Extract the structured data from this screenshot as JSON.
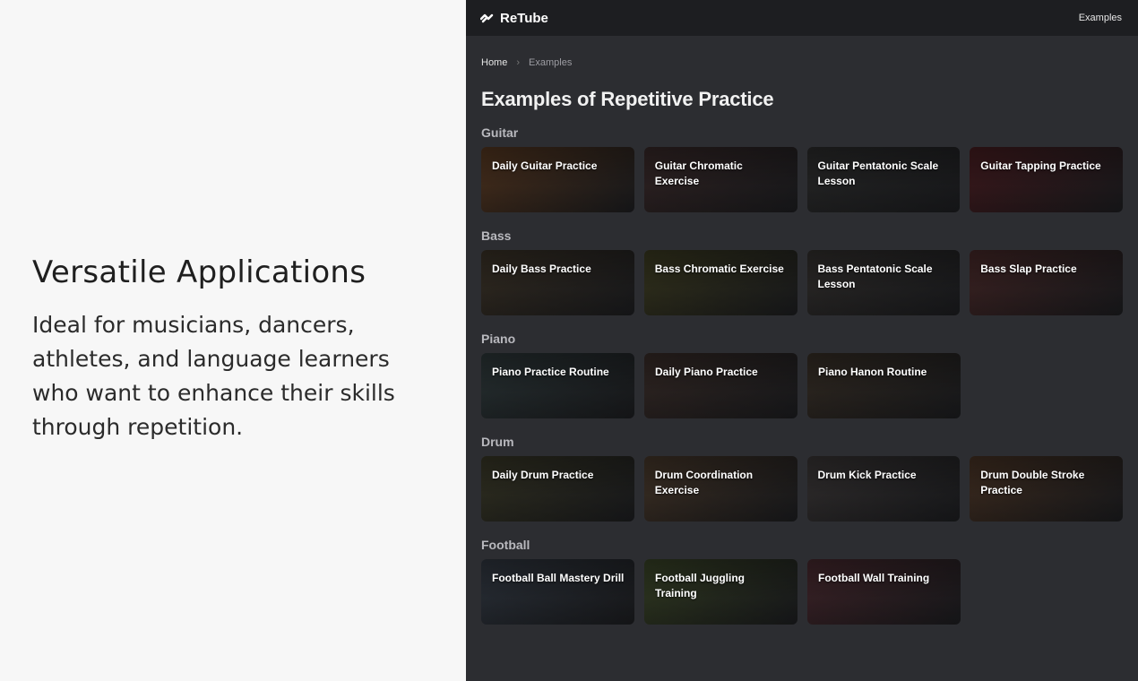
{
  "promo": {
    "title": "Versatile Applications",
    "text": "Ideal for musicians, dancers, athletes, and language learners who want to enhance their skills through repetition."
  },
  "app": {
    "brand": "ReTube",
    "nav_examples": "Examples",
    "breadcrumb": {
      "home": "Home",
      "separator": "›",
      "current": "Examples"
    },
    "page_title": "Examples of Repetitive Practice",
    "sections": [
      {
        "title": "Guitar",
        "cards": [
          {
            "label": "Daily Guitar Practice",
            "color": "#5a3a22"
          },
          {
            "label": "Guitar Chromatic Exercise",
            "color": "#3a2a2a"
          },
          {
            "label": "Guitar Pentatonic Scale Lesson",
            "color": "#2e2e2e"
          },
          {
            "label": "Guitar Tapping Practice",
            "color": "#4a1e22"
          }
        ]
      },
      {
        "title": "Bass",
        "cards": [
          {
            "label": "Daily Bass Practice",
            "color": "#3d3428"
          },
          {
            "label": "Bass Chromatic Exercise",
            "color": "#3e3d22"
          },
          {
            "label": "Bass Pentatonic Scale Lesson",
            "color": "#353230"
          },
          {
            "label": "Bass Slap Practice",
            "color": "#4a2a2a"
          }
        ]
      },
      {
        "title": "Piano",
        "cards": [
          {
            "label": "Piano Practice Routine",
            "color": "#2f3a3c"
          },
          {
            "label": "Daily Piano Practice",
            "color": "#3b2e2a"
          },
          {
            "label": "Piano Hanon Routine",
            "color": "#3a3128"
          }
        ]
      },
      {
        "title": "Drum",
        "cards": [
          {
            "label": "Daily Drum Practice",
            "color": "#3b3a28"
          },
          {
            "label": "Drum Coordination Exercise",
            "color": "#4a3a2c"
          },
          {
            "label": "Drum Kick Practice",
            "color": "#3c3838"
          },
          {
            "label": "Drum Double Stroke Practice",
            "color": "#4b3526"
          }
        ]
      },
      {
        "title": "Football",
        "cards": [
          {
            "label": "Football Ball Mastery Drill",
            "color": "#333a44"
          },
          {
            "label": "Football Juggling Training",
            "color": "#3b4628"
          },
          {
            "label": "Football Wall Training",
            "color": "#4a2a30"
          }
        ]
      }
    ]
  }
}
